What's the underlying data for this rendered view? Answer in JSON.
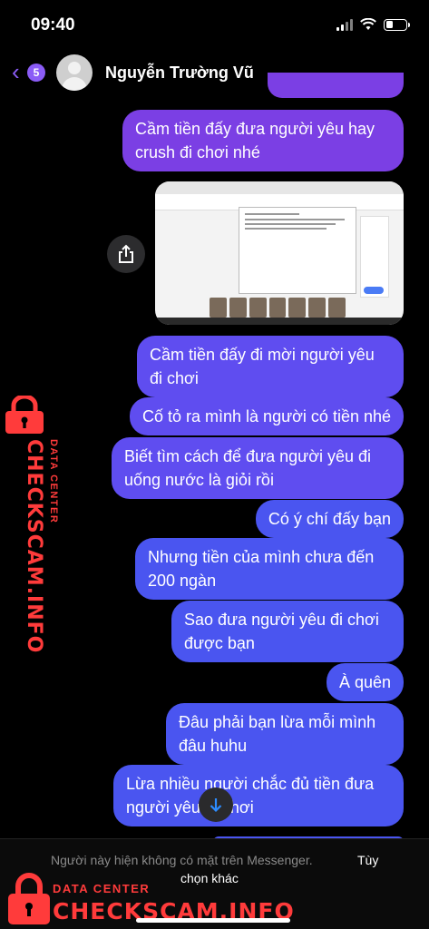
{
  "status_bar": {
    "time": "09:40"
  },
  "header": {
    "back_count": "5",
    "contact_name": "Nguyễn Trường Vũ"
  },
  "messages": [
    {
      "text": "Cầm tiền đấy đưa người yêu hay crush đi chơi nhé",
      "style": "purple"
    },
    {
      "text": "Cầm tiền đấy đi mời người yêu đi chơi",
      "style": "violet"
    },
    {
      "text": "Cố tỏ ra mình là người có tiền nhé",
      "style": "violet"
    },
    {
      "text": "Biết tìm cách để đưa người yêu đi uống nước là giỏi rồi",
      "style": "violet"
    },
    {
      "text": "Có ý chí đấy bạn",
      "style": "blue"
    },
    {
      "text": "Nhưng tiền của mình chưa đến 200 ngàn",
      "style": "blue"
    },
    {
      "text": "Sao đưa người yêu đi chơi được bạn",
      "style": "blue"
    },
    {
      "text": "À quên",
      "style": "blue"
    },
    {
      "text": "Đâu phải bạn lừa mỗi mình đâu huhu",
      "style": "blue"
    },
    {
      "text": "Lừa nhiều người chắc đủ tiền đưa người yêu đi chơi",
      "style": "blue"
    }
  ],
  "footer": {
    "notice": "Người này hiện không có mặt trên Messenger.",
    "link_part1": "Tùy",
    "link_part2": "chọn khác"
  },
  "watermark": {
    "small": "DATA CENTER",
    "big": "CHECKSCAM.INFO"
  },
  "colors": {
    "accent": "#8b5cf6",
    "bubble_purple": "#7b3fe4",
    "bubble_violet": "#5f4df0",
    "bubble_blue": "#4a55f0",
    "watermark": "#ff3b3b"
  }
}
